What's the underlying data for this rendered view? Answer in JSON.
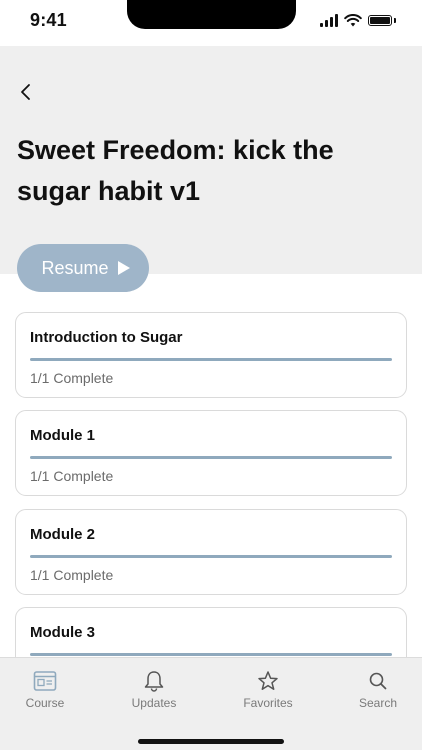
{
  "status_bar": {
    "time": "9:41"
  },
  "header": {
    "back_icon": "chevron-left-icon",
    "title": "Sweet Freedom: kick the sugar habit v1"
  },
  "resume_button": {
    "label": "Resume",
    "icon": "play-icon",
    "color": "#9fb5c9"
  },
  "modules": [
    {
      "title": "Introduction to Sugar",
      "status": "1/1 Complete",
      "progress": 1.0
    },
    {
      "title": "Module 1",
      "status": "1/1 Complete",
      "progress": 1.0
    },
    {
      "title": "Module 2",
      "status": "1/1 Complete",
      "progress": 1.0
    },
    {
      "title": "Module 3",
      "status": "",
      "progress": 1.0
    }
  ],
  "tabbar": {
    "tabs": [
      {
        "label": "Course",
        "icon": "course-icon"
      },
      {
        "label": "Updates",
        "icon": "bell-icon"
      },
      {
        "label": "Favorites",
        "icon": "star-icon"
      },
      {
        "label": "Search",
        "icon": "search-icon"
      }
    ]
  },
  "colors": {
    "accent": "#8fa9bd",
    "header_bg": "#efefef"
  }
}
